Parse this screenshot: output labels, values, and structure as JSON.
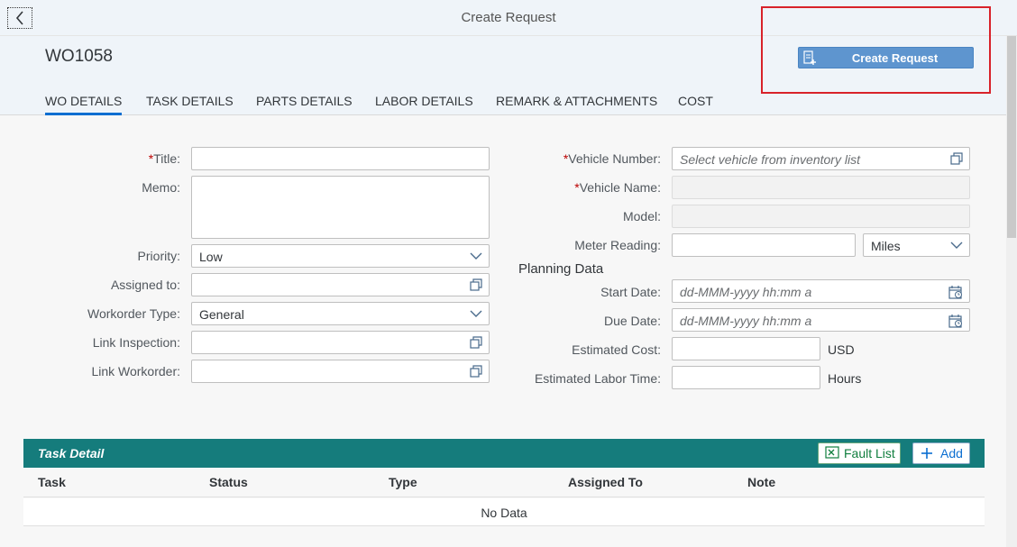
{
  "window": {
    "title": "Create Request"
  },
  "header": {
    "wo_id": "WO1058",
    "create_button": "Create Request"
  },
  "tabs": [
    {
      "label": "WO DETAILS",
      "active": true
    },
    {
      "label": "TASK DETAILS"
    },
    {
      "label": "PARTS DETAILS"
    },
    {
      "label": "LABOR DETAILS"
    },
    {
      "label": "REMARK & ATTACHMENTS"
    },
    {
      "label": "COST"
    }
  ],
  "form_left": {
    "title_label": "Title:",
    "title_value": "",
    "memo_label": "Memo:",
    "memo_value": "",
    "priority_label": "Priority:",
    "priority_value": "Low",
    "assigned_label": "Assigned to:",
    "assigned_value": "",
    "wo_type_label": "Workorder Type:",
    "wo_type_value": "General",
    "link_inspection_label": "Link Inspection:",
    "link_inspection_value": "",
    "link_workorder_label": "Link Workorder:",
    "link_workorder_value": ""
  },
  "form_right": {
    "vehicle_number_label": "Vehicle Number:",
    "vehicle_number_placeholder": "Select vehicle from inventory list",
    "vehicle_name_label": "Vehicle Name:",
    "model_label": "Model:",
    "meter_label": "Meter Reading:",
    "meter_unit": "Miles",
    "planning_title": "Planning Data",
    "start_label": "Start Date:",
    "start_placeholder": "dd-MMM-yyyy hh:mm a",
    "due_label": "Due Date:",
    "due_placeholder": "dd-MMM-yyyy hh:mm a",
    "cost_label": "Estimated Cost:",
    "cost_unit": "USD",
    "labor_label": "Estimated Labor Time:",
    "labor_unit": "Hours"
  },
  "required_mark": "*",
  "task_table": {
    "title": "Task Detail",
    "fault_list_button": "Fault List",
    "add_button": "Add",
    "columns": [
      "Task",
      "Status",
      "Type",
      "Assigned To",
      "Note"
    ],
    "empty_text": "No Data"
  },
  "colors": {
    "accent": "#0a6ed1",
    "primary_button": "#5e95cf",
    "table_header": "#157c7c",
    "highlight": "#d8222a"
  }
}
